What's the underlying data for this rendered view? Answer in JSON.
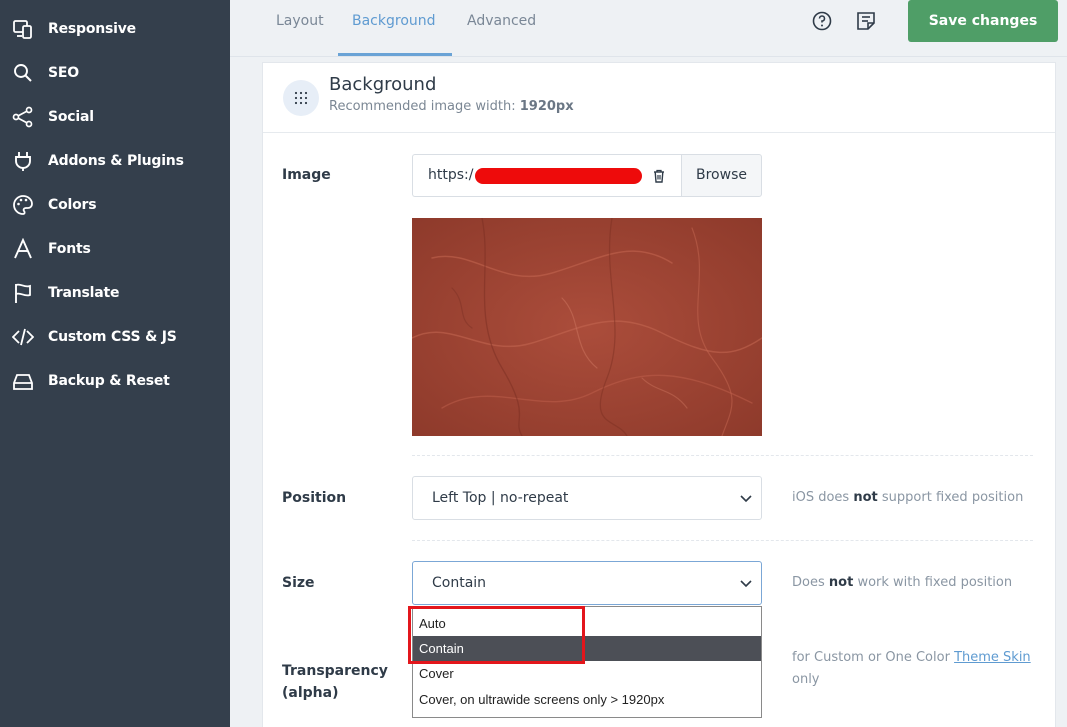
{
  "sidebar": {
    "items": [
      {
        "label": "Responsive",
        "icon": "responsive-icon"
      },
      {
        "label": "SEO",
        "icon": "search-icon"
      },
      {
        "label": "Social",
        "icon": "share-icon"
      },
      {
        "label": "Addons & Plugins",
        "icon": "plug-icon"
      },
      {
        "label": "Colors",
        "icon": "palette-icon"
      },
      {
        "label": "Fonts",
        "icon": "font-icon"
      },
      {
        "label": "Translate",
        "icon": "flag-icon"
      },
      {
        "label": "Custom CSS & JS",
        "icon": "code-icon"
      },
      {
        "label": "Backup & Reset",
        "icon": "hard-drive-icon"
      }
    ]
  },
  "tabs": [
    {
      "label": "Layout",
      "active": false
    },
    {
      "label": "Background",
      "active": true
    },
    {
      "label": "Advanced",
      "active": false
    }
  ],
  "toolbar": {
    "help_icon": "help-circle-icon",
    "notes_icon": "notes-icon",
    "save_label": "Save changes",
    "save_color": "#4f9e67"
  },
  "section": {
    "title": "Background",
    "subtitle_prefix": "Recommended image width:",
    "subtitle_value": "1920px"
  },
  "image": {
    "label": "Image",
    "url_prefix": "https:/",
    "browse_label": "Browse",
    "preview_color": "#a04534"
  },
  "position": {
    "label": "Position",
    "value": "Left Top | no-repeat",
    "hint_prefix": "iOS does",
    "hint_bold": "not",
    "hint_suffix": "support fixed position"
  },
  "size": {
    "label": "Size",
    "value": "Contain",
    "hint_prefix": "Does",
    "hint_bold": "not",
    "hint_suffix": "work with fixed position",
    "options": [
      "Auto",
      "Contain",
      "Cover",
      "Cover, on ultrawide screens only > 1920px"
    ],
    "selected_index": 1
  },
  "transparency": {
    "label_line1": "Transparency",
    "label_line2": "(alpha)",
    "hint_prefix": "for Custom or One Color",
    "hint_link": "Theme Skin",
    "hint_suffix": "only"
  },
  "colors": {
    "sidebar_bg": "#343f4c",
    "accent": "#5f9bd1",
    "highlight": "#e3161c"
  }
}
